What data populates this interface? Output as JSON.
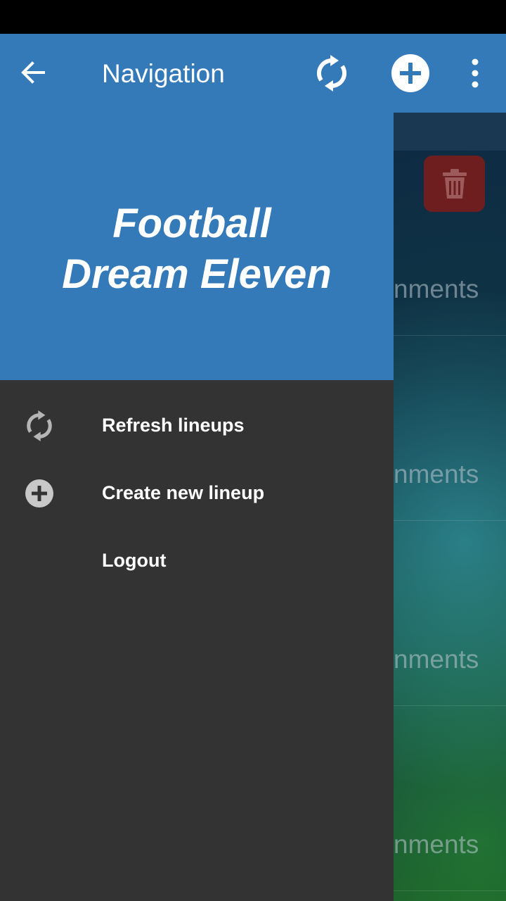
{
  "app_bar": {
    "title": "Navigation",
    "back_icon": "arrow-back-icon",
    "actions": [
      "refresh-icon",
      "add-circle-icon",
      "more-vert-icon"
    ],
    "color": "#3479b8"
  },
  "drawer": {
    "header": {
      "title_line1": "Football",
      "title_line2": "Dream Eleven"
    },
    "items": [
      {
        "label": "Refresh lineups",
        "icon": "refresh-icon"
      },
      {
        "label": "Create new lineup",
        "icon": "add-circle-icon"
      },
      {
        "label": "Logout",
        "icon": ""
      }
    ],
    "background_color": "#333333"
  },
  "background": {
    "row_labels": [
      "nments",
      "nments",
      "nments",
      "nments"
    ],
    "delete_icon": "trash-icon"
  }
}
